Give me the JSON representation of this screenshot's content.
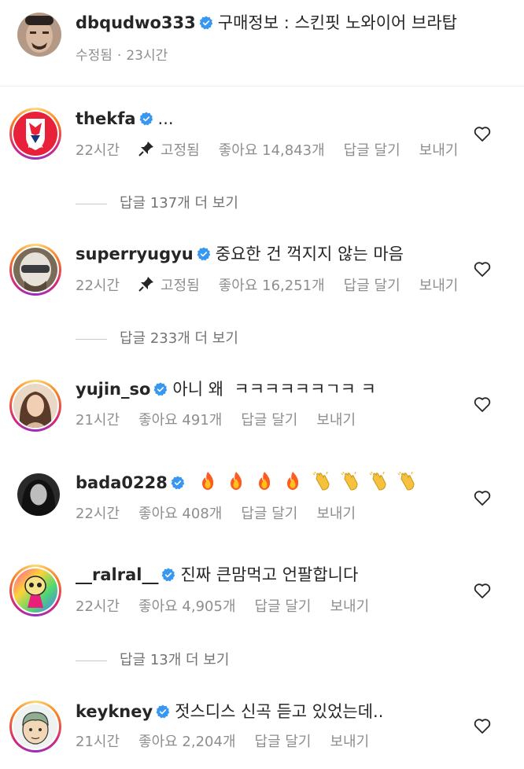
{
  "post": {
    "username": "dbqudwo333",
    "caption": "구매정보 : 스킨핏 노와이어 브라탑",
    "edited": "수정됨",
    "separator": "·",
    "time": "23시간"
  },
  "comments": [
    {
      "username": "thekfa",
      "text": "...",
      "time": "22시간",
      "pinned": "고정됨",
      "likes": "좋아요 14,843개",
      "reply": "답글 달기",
      "send": "보내기",
      "view_replies": "답글 137개 더 보기",
      "avatar": "kfa-logo"
    },
    {
      "username": "superryugyu",
      "text": "중요한 건 꺽지지 않는 마음",
      "time": "22시간",
      "pinned": "고정됨",
      "likes": "좋아요 16,251개",
      "reply": "답글 달기",
      "send": "보내기",
      "view_replies": "답글 233개 더 보기",
      "avatar": "helmet-photo"
    },
    {
      "username": "yujin_so",
      "text": "아니 왜  ㅋㅋㅋㅋㅋㅋㄱㅋ ㅋ",
      "time": "21시간",
      "likes": "좋아요 491개",
      "reply": "답글 달기",
      "send": "보내기",
      "avatar": "portrait-photo"
    },
    {
      "username": "bada0228",
      "text_emojis": [
        "fire",
        "fire",
        "fire",
        "fire",
        "clap",
        "clap",
        "clap",
        "clap"
      ],
      "time": "22시간",
      "likes": "좋아요 408개",
      "reply": "답글 달기",
      "send": "보내기",
      "avatar": "bw-portrait"
    },
    {
      "username": "__ralral__",
      "text": "진짜 큰맘먹고 언팔합니다",
      "time": "22시간",
      "likes": "좋아요 4,905개",
      "reply": "답글 달기",
      "send": "보내기",
      "view_replies": "답글 13개 더 보기",
      "avatar": "cartoon-character"
    },
    {
      "username": "keykney",
      "text": "젓스디스 신곡 듣고 있었는데..",
      "time": "21시간",
      "likes": "좋아요 2,204개",
      "reply": "답글 달기",
      "send": "보내기",
      "avatar": "cartoon-face"
    }
  ],
  "colors": {
    "verified": "#3897f0",
    "meta": "#8e8e8e",
    "text": "#262626"
  }
}
